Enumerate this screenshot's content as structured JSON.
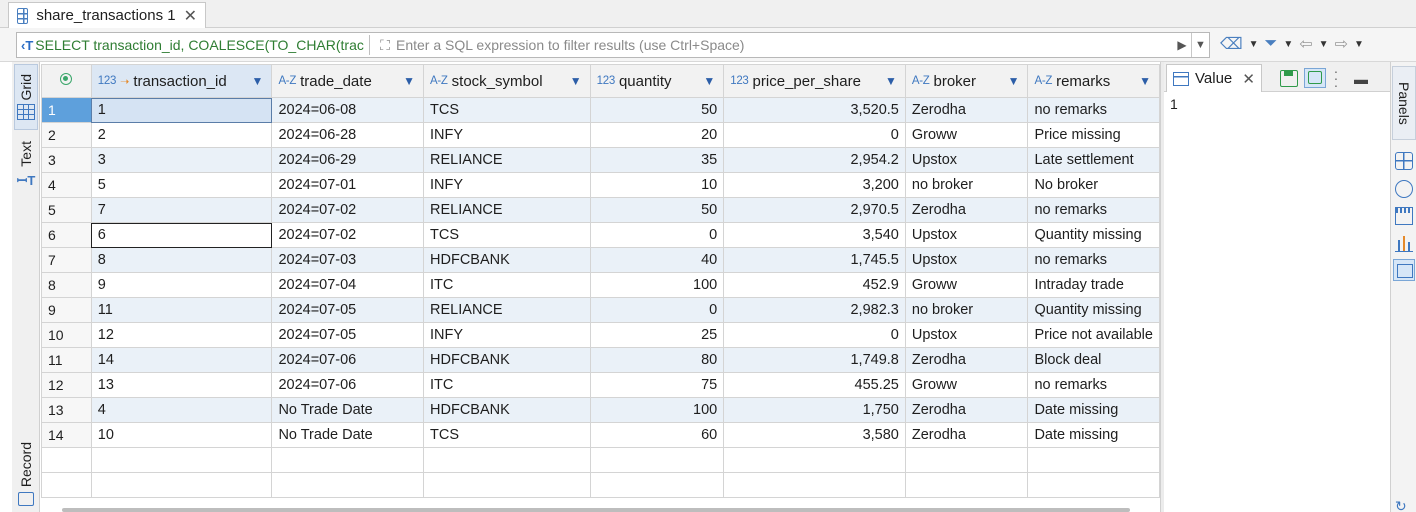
{
  "tab": {
    "title": "share_transactions 1",
    "close_glyph": "✕"
  },
  "filter": {
    "sql_prefix": "SELECT transaction_id, COALESCE(TO_CHAR(trac",
    "placeholder": "Enter a SQL expression to filter results (use Ctrl+Space)"
  },
  "left_tabs": {
    "grid": "Grid",
    "text": "Text",
    "record": "Record"
  },
  "columns": [
    {
      "type": "123",
      "name": "transaction_id",
      "key": true
    },
    {
      "type": "A-Z",
      "name": "trade_date"
    },
    {
      "type": "A-Z",
      "name": "stock_symbol"
    },
    {
      "type": "123",
      "name": "quantity"
    },
    {
      "type": "123",
      "name": "price_per_share"
    },
    {
      "type": "A-Z",
      "name": "broker"
    },
    {
      "type": "A-Z",
      "name": "remarks"
    }
  ],
  "rows": [
    [
      "1",
      "1",
      "2024=06-08",
      "TCS",
      "50",
      "3,520.5",
      "Zerodha",
      "no remarks"
    ],
    [
      "2",
      "2",
      "2024=06-28",
      "INFY",
      "20",
      "0",
      "Groww",
      "Price missing"
    ],
    [
      "3",
      "3",
      "2024=06-29",
      "RELIANCE",
      "35",
      "2,954.2",
      "Upstox",
      "Late settlement"
    ],
    [
      "4",
      "5",
      "2024=07-01",
      "INFY",
      "10",
      "3,200",
      "no broker",
      "No broker"
    ],
    [
      "5",
      "7",
      "2024=07-02",
      "RELIANCE",
      "50",
      "2,970.5",
      "Zerodha",
      "no remarks"
    ],
    [
      "6",
      "6",
      "2024=07-02",
      "TCS",
      "0",
      "3,540",
      "Upstox",
      "Quantity missing"
    ],
    [
      "7",
      "8",
      "2024=07-03",
      "HDFCBANK",
      "40",
      "1,745.5",
      "Upstox",
      "no remarks"
    ],
    [
      "8",
      "9",
      "2024=07-04",
      "ITC",
      "100",
      "452.9",
      "Groww",
      "Intraday trade"
    ],
    [
      "9",
      "11",
      "2024=07-05",
      "RELIANCE",
      "0",
      "2,982.3",
      "no broker",
      "Quantity missing"
    ],
    [
      "10",
      "12",
      "2024=07-05",
      "INFY",
      "25",
      "0",
      "Upstox",
      "Price not available"
    ],
    [
      "11",
      "14",
      "2024=07-06",
      "HDFCBANK",
      "80",
      "1,749.8",
      "Zerodha",
      "Block deal"
    ],
    [
      "12",
      "13",
      "2024=07-06",
      "ITC",
      "75",
      "455.25",
      "Groww",
      "no remarks"
    ],
    [
      "13",
      "4",
      "No Trade Date",
      "HDFCBANK",
      "100",
      "1,750",
      "Zerodha",
      "Date missing"
    ],
    [
      "14",
      "10",
      "No Trade Date",
      "TCS",
      "60",
      "3,580",
      "Zerodha",
      "Date missing"
    ]
  ],
  "value_panel": {
    "title": "Value",
    "value": "1"
  },
  "right_tabs": {
    "panels": "Panels"
  }
}
